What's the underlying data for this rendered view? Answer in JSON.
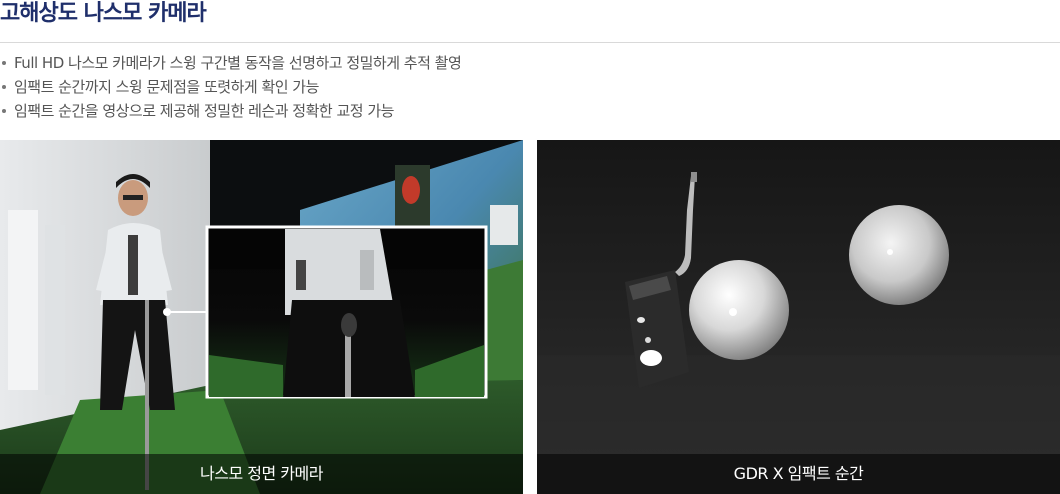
{
  "title": "고해상도 나스모 카메라",
  "features": [
    "Full HD 나스모 카메라가 스윙 구간별 동작을 선명하고 정밀하게 추적 촬영",
    "임팩트 순간까지 스윙 문제점을 또렷하게 확인 가능",
    "임팩트 순간을 영상으로 제공해 정밀한 레슨과 정확한 교정 가능"
  ],
  "photos": {
    "left": {
      "caption": "나스모 정면 카메라"
    },
    "right": {
      "caption": "GDR X 임팩트 순간"
    }
  },
  "colors": {
    "title": "#1f2f6b",
    "body_text": "#555555",
    "caption_bg": "rgba(0,0,0,0.55)"
  }
}
